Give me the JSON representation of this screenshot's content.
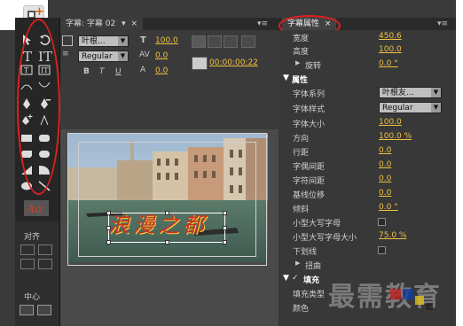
{
  "tabs": {
    "title_panel": "字幕: 字幕 02",
    "title_props": "字幕属性"
  },
  "toolbar": {
    "font_family": "叶根...",
    "font_style": "Regular",
    "size_value": "100.0",
    "kerning_value": "0.0",
    "leading_value": "0.0",
    "timecode": "00:00:00:22",
    "bold": "B",
    "italic": "T",
    "underline": "U"
  },
  "canvas": {
    "title_text": "浪漫之都"
  },
  "left_panel": {
    "align_label": "对齐",
    "center_label": "中心"
  },
  "properties": {
    "rows": [
      {
        "label": "宽度",
        "value": "450.6"
      },
      {
        "label": "高度",
        "value": "100.0"
      },
      {
        "label": "旋转",
        "value": "0.0 °"
      },
      {
        "label": "属性",
        "value": ""
      },
      {
        "label": "字体系列",
        "value": "叶根友..."
      },
      {
        "label": "字体样式",
        "value": "Regular"
      },
      {
        "label": "字体大小",
        "value": "100.0"
      },
      {
        "label": "方向",
        "value": "100.0 %"
      },
      {
        "label": "行距",
        "value": "0.0"
      },
      {
        "label": "字偶间距",
        "value": "0.0"
      },
      {
        "label": "字符间距",
        "value": "0.0"
      },
      {
        "label": "基线位移",
        "value": "0.0"
      },
      {
        "label": "倾斜",
        "value": "0.0 °"
      },
      {
        "label": "小型大写字母",
        "value": ""
      },
      {
        "label": "小型大写字母大小",
        "value": "75.0 %"
      },
      {
        "label": "下划线",
        "value": ""
      },
      {
        "label": "扭曲",
        "value": ""
      },
      {
        "label": "填充",
        "value": ""
      },
      {
        "label": "填充类型",
        "value": ""
      },
      {
        "label": "颜色",
        "value": ""
      }
    ]
  },
  "watermark": "最需教育",
  "colors": {
    "accent_red": "#e02020",
    "value_yellow": "#f0c040",
    "panel_bg": "#383838"
  }
}
